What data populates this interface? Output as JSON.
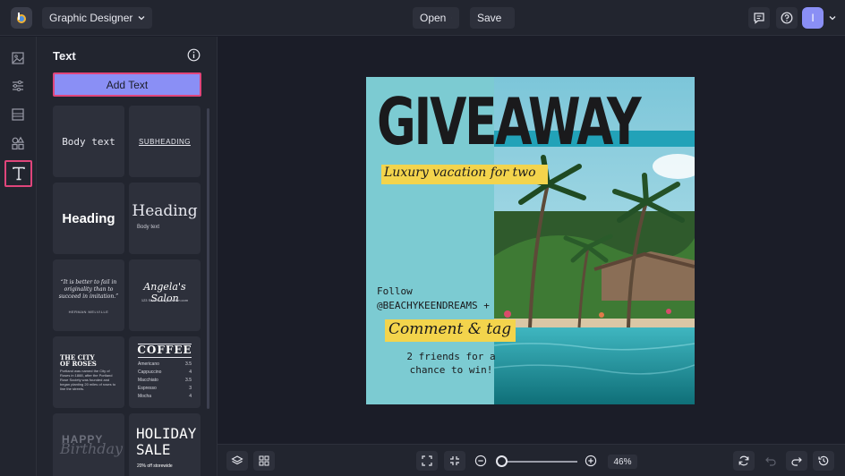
{
  "topbar": {
    "mode_label": "Graphic Designer",
    "open_label": "Open",
    "save_label": "Save",
    "avatar_initial": "I"
  },
  "rail": {
    "items": [
      "image-icon",
      "sliders-icon",
      "layout-icon",
      "shapes-icon",
      "text-icon"
    ],
    "active": "text-icon"
  },
  "panel": {
    "title": "Text",
    "add_text_label": "Add Text",
    "tiles": {
      "body_text": "Body text",
      "subheading": "SUBHEADING",
      "heading_bold": "Heading",
      "heading_serif": "Heading",
      "heading_serif_body": "Body text",
      "quote": "“It is better to fail in originality than to succeed in imitation.”",
      "quote_author": "HERMAN MELVILLE",
      "salon": "Angela's Salon",
      "salon_small": "123 Street · angelasalon.com",
      "city_title_1": "THE CITY",
      "city_title_2": "OF ROSES",
      "city_body": "Portland was named the City of Roses in 1888, after the Portland Rose Society was founded and began planting 20 miles of roses to line the streets.",
      "coffee_title": "COFFEE",
      "coffee_menu": [
        {
          "item": "Americano",
          "price": "3.5"
        },
        {
          "item": "Cappuccino",
          "price": "4"
        },
        {
          "item": "Macchiato",
          "price": "3.5"
        },
        {
          "item": "Espresso",
          "price": "3"
        },
        {
          "item": "Mocha",
          "price": "4"
        }
      ],
      "happy": "HAPPY",
      "birthday": "Birthday",
      "holiday_1": "HOLIDAY",
      "holiday_2": "SALE",
      "holiday_small": "20% off storewide"
    }
  },
  "design": {
    "title": "GIVEAWAY",
    "subtitle": "Luxury vacation for two",
    "follow_1": "Follow",
    "follow_2": "@BEACHYKEENDREAMS +",
    "cta": "Comment & tag",
    "friends_1": "2 friends for a",
    "friends_2": "chance to win!",
    "colors": {
      "background": "#7ccbd2",
      "highlight": "#f3d44c"
    }
  },
  "bottombar": {
    "zoom_value": "46%",
    "zoom_fraction": 0.05
  }
}
